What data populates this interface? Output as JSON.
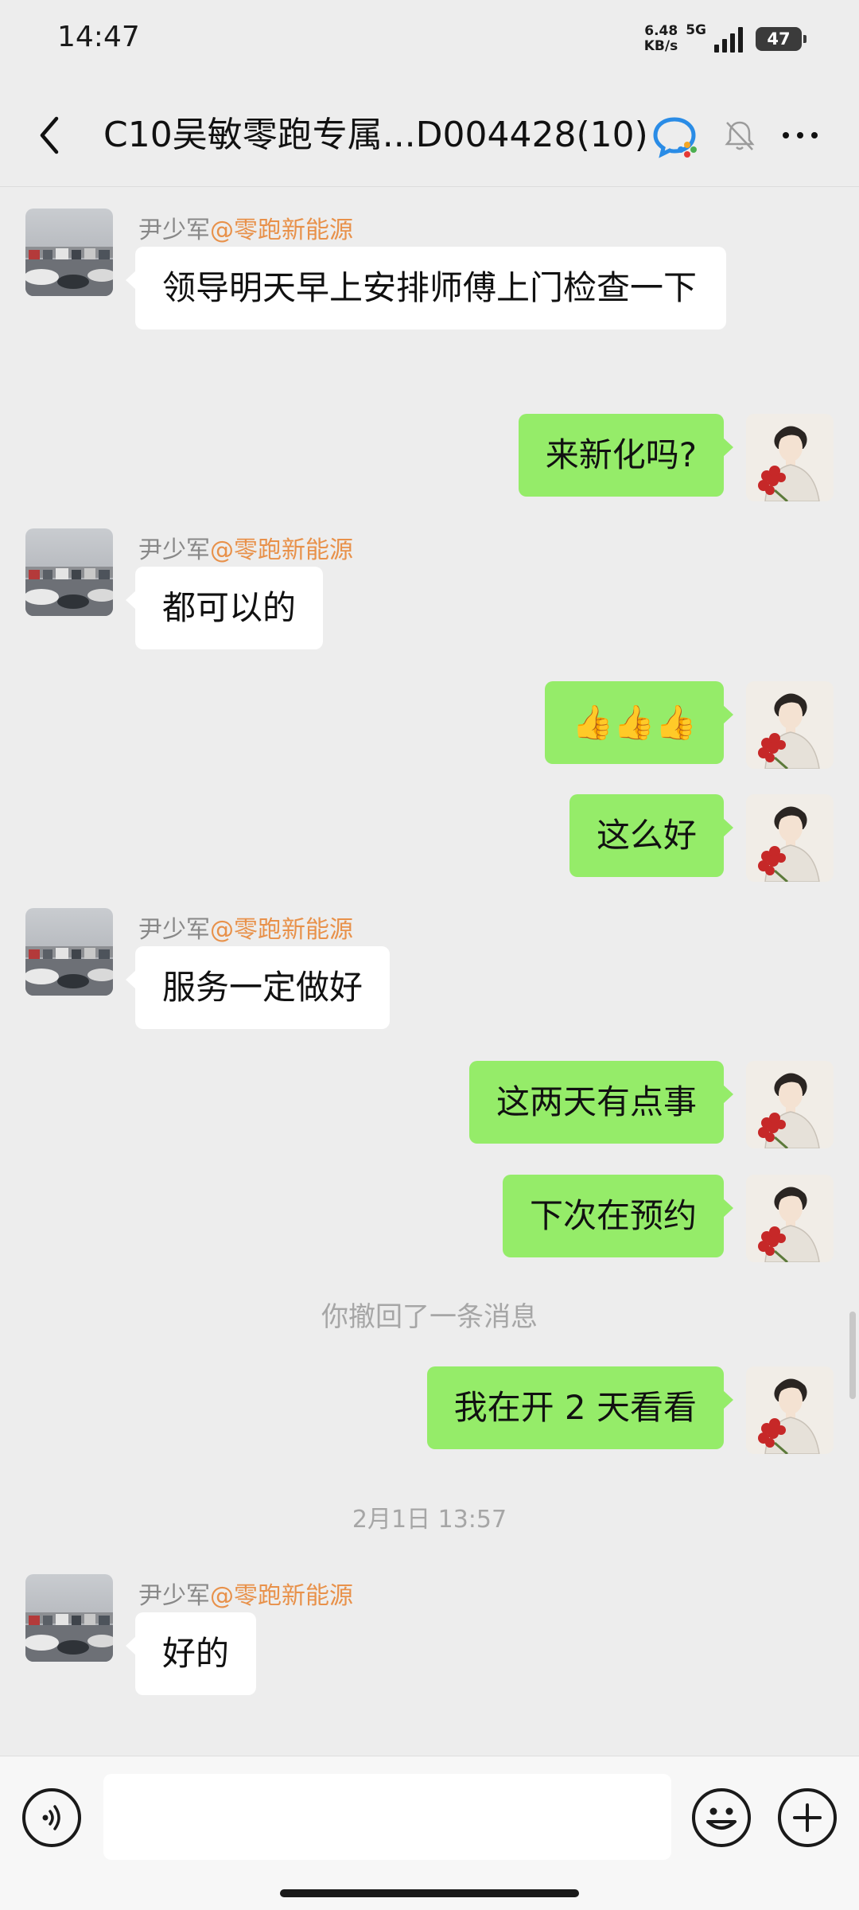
{
  "status_bar": {
    "time": "14:47",
    "net_speed_value": "6.48",
    "net_speed_unit": "KB/s",
    "network": "5G",
    "battery": "47"
  },
  "header": {
    "title": "C10吴敏零跑专属...D004428(10)",
    "icons": [
      "back-icon",
      "wecom-icon",
      "mute-bell-icon",
      "more-icon"
    ]
  },
  "messages": {
    "m1": {
      "sender": "尹少军",
      "org": "@零跑新能源",
      "text": "领导明天早上安排师傅上门检查一下"
    },
    "m2": {
      "text": "来新化吗?"
    },
    "m3": {
      "sender": "尹少军",
      "org": "@零跑新能源",
      "text": "都可以的"
    },
    "m4": {
      "text": "👍👍👍"
    },
    "m5": {
      "text": "这么好"
    },
    "m6": {
      "sender": "尹少军",
      "org": "@零跑新能源",
      "text": "服务一定做好"
    },
    "m7": {
      "text": "这两天有点事"
    },
    "m8": {
      "text": "下次在预约"
    },
    "recall_notice": "你撤回了一条消息",
    "m9": {
      "text": "我在开 2 天看看"
    },
    "timestamp": "2月1日 13:57",
    "m10": {
      "sender": "尹少军",
      "org": "@零跑新能源",
      "text": "好的"
    }
  },
  "input_bar": {
    "placeholder": "",
    "icons": [
      "voice-icon",
      "emoji-icon",
      "plus-icon"
    ]
  },
  "colors": {
    "background": "#ededed",
    "outgoing_bubble": "#95ec69",
    "incoming_bubble": "#ffffff",
    "org_tag": "#e8914a"
  }
}
